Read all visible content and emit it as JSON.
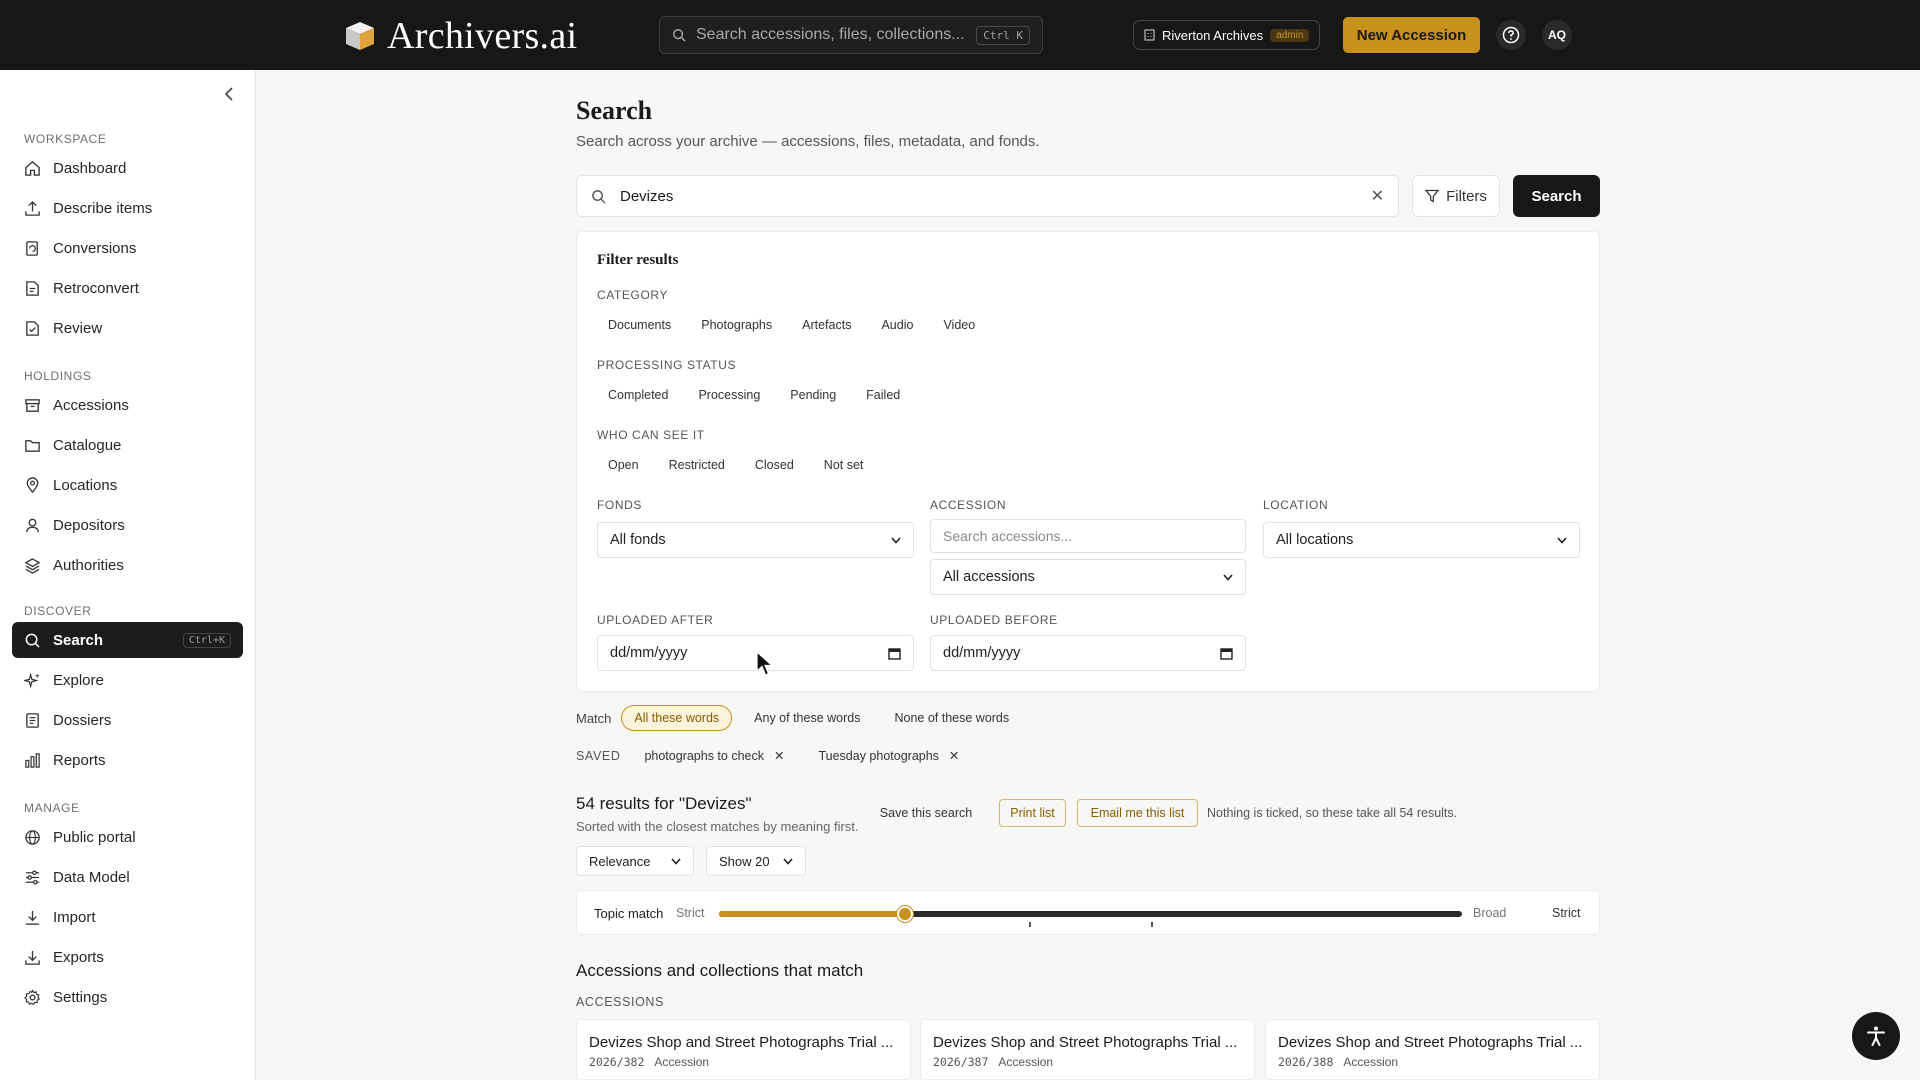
{
  "app": {
    "logo_text": "Archivers.ai",
    "search_placeholder": "Search accessions, files, collections...",
    "search_shortcut": "Ctrl K",
    "org_name": "Riverton Archives",
    "org_role": "admin",
    "new_button": "New Accession",
    "avatar_initials": "AQ",
    "accent_color": "#c8901c"
  },
  "sidebar": {
    "sections": [
      {
        "label": "WORKSPACE",
        "items": [
          {
            "label": "Dashboard",
            "icon": "home-icon"
          },
          {
            "label": "Describe items",
            "icon": "upload-icon"
          },
          {
            "label": "Conversions",
            "icon": "convert-icon"
          },
          {
            "label": "Retroconvert",
            "icon": "retroconvert-icon"
          },
          {
            "label": "Review",
            "icon": "review-icon"
          }
        ]
      },
      {
        "label": "HOLDINGS",
        "items": [
          {
            "label": "Accessions",
            "icon": "archive-box-icon"
          },
          {
            "label": "Catalogue",
            "icon": "folder-icon"
          },
          {
            "label": "Locations",
            "icon": "map-pin-icon"
          },
          {
            "label": "Depositors",
            "icon": "user-icon"
          },
          {
            "label": "Authorities",
            "icon": "stack-icon"
          }
        ]
      },
      {
        "label": "DISCOVER",
        "items": [
          {
            "label": "Search",
            "icon": "search-icon",
            "shortcut": "Ctrl+K",
            "active": true
          },
          {
            "label": "Explore",
            "icon": "sparkle-icon"
          },
          {
            "label": "Dossiers",
            "icon": "dossier-icon"
          },
          {
            "label": "Reports",
            "icon": "bar-chart-icon"
          }
        ]
      },
      {
        "label": "MANAGE",
        "items": [
          {
            "label": "Public portal",
            "icon": "globe-icon"
          },
          {
            "label": "Data Model",
            "icon": "sliders-icon"
          },
          {
            "label": "Import",
            "icon": "download-icon"
          },
          {
            "label": "Exports",
            "icon": "export-icon"
          },
          {
            "label": "Settings",
            "icon": "gear-icon"
          }
        ]
      }
    ]
  },
  "page": {
    "title": "Search",
    "subtitle": "Search across your archive — accessions, files, metadata, and fonds.",
    "query": "Devizes",
    "filters_button": "Filters",
    "search_button": "Search"
  },
  "filters": {
    "title": "Filter results",
    "category_label": "CATEGORY",
    "categories": [
      "Documents",
      "Photographs",
      "Artefacts",
      "Audio",
      "Video"
    ],
    "status_label": "PROCESSING STATUS",
    "statuses": [
      "Completed",
      "Processing",
      "Pending",
      "Failed"
    ],
    "visibility_label": "WHO CAN SEE IT",
    "visibility": [
      "Open",
      "Restricted",
      "Closed",
      "Not set"
    ],
    "fonds_label": "FONDS",
    "fonds_value": "All fonds",
    "accession_label": "ACCESSION",
    "accession_placeholder": "Search accessions...",
    "accession_value": "All accessions",
    "location_label": "LOCATION",
    "location_value": "All locations",
    "after_label": "UPLOADED AFTER",
    "after_value": "dd/mm/yyyy",
    "before_label": "UPLOADED BEFORE",
    "before_value": "dd/mm/yyyy"
  },
  "match": {
    "label": "Match",
    "options": [
      "All these words",
      "Any of these words",
      "None of these words"
    ],
    "active": 0
  },
  "saved": {
    "label": "SAVED",
    "items": [
      "photographs to check",
      "Tuesday photographs"
    ]
  },
  "results": {
    "title": "54 results for \"Devizes\"",
    "subtitle": "Sorted with the closest matches by meaning first.",
    "save_search": "Save this search",
    "print_list": "Print list",
    "email_list": "Email me this list",
    "nothing_ticked": "Nothing is ticked, so these take all 54 results.",
    "sort_value": "Relevance",
    "show_value": "Show 20"
  },
  "topic_match": {
    "label": "Topic match",
    "left_label": "Strict",
    "right_label": "Broad",
    "value_label": "Strict",
    "value_fraction": 0.25
  },
  "matches": {
    "heading": "Accessions and collections that match",
    "accessions_label": "ACCESSIONS",
    "cards": [
      {
        "title": "Devizes Shop and Street Photographs Trial ...",
        "code": "2026/382",
        "type": "Accession"
      },
      {
        "title": "Devizes Shop and Street Photographs Trial ...",
        "code": "2026/387",
        "type": "Accession"
      },
      {
        "title": "Devizes Shop and Street Photographs Trial ...",
        "code": "2026/388",
        "type": "Accession"
      }
    ]
  }
}
